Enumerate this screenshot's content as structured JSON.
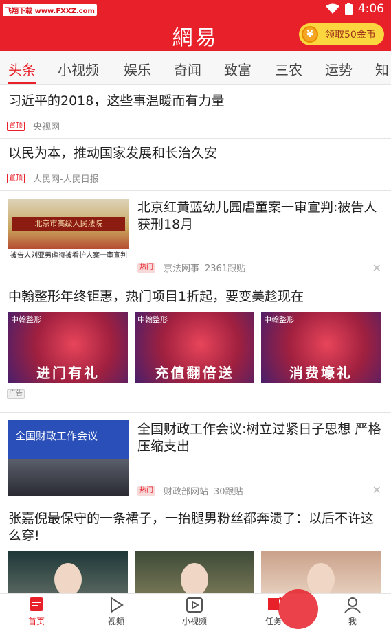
{
  "status_bar": {
    "watermark": "飞翔下载 www.FXXZ.com",
    "time": "4:06"
  },
  "header": {
    "logo": "網易",
    "coin_button_label": "领取50金币",
    "coin_symbol": "¥"
  },
  "tabs": [
    "头条",
    "小视频",
    "娱乐",
    "奇闻",
    "致富",
    "三农",
    "运势",
    "知"
  ],
  "feed": [
    {
      "title": "习近平的2018，这些事温暖而有力量",
      "tag": "置顶",
      "source": "央视网"
    },
    {
      "title": "以民为本，推动国家发展和长治久安",
      "tag": "置顶",
      "source": "人民网-人民日报"
    },
    {
      "title": "北京红黄蓝幼儿园虐童案一审宣判:被告人获刑18月",
      "tag": "热门",
      "source": "京法网事",
      "comments": "2361跟贴",
      "thumb_sign": "北京市高级人民法院",
      "thumb_caption": "被告人刘亚男虐待被看护人案一审宣判"
    },
    {
      "title": "中翰整形年终钜惠，热门项目1折起，要变美趁现在",
      "tag": "广告",
      "ad_images": [
        {
          "brand": "中翰整形",
          "text": "进门有礼"
        },
        {
          "brand": "中翰整形",
          "text": "充值翻倍送"
        },
        {
          "brand": "中翰整形",
          "text": "消费壕礼"
        }
      ]
    },
    {
      "title": "全国财政工作会议:树立过紧日子思想 严格压缩支出",
      "tag": "热门",
      "source": "财政部网站",
      "comments": "30跟贴",
      "thumb_banner": "全国财政工作会议"
    },
    {
      "title": "张嘉倪最保守的一条裙子，一抬腿男粉丝都奔溃了：以后不许这么穿!"
    }
  ],
  "bottom_nav": [
    "首页",
    "视频",
    "小视频",
    "任务",
    "我"
  ],
  "colors": {
    "brand_red": "#e8202a",
    "coin_yellow": "#fbd63e"
  }
}
